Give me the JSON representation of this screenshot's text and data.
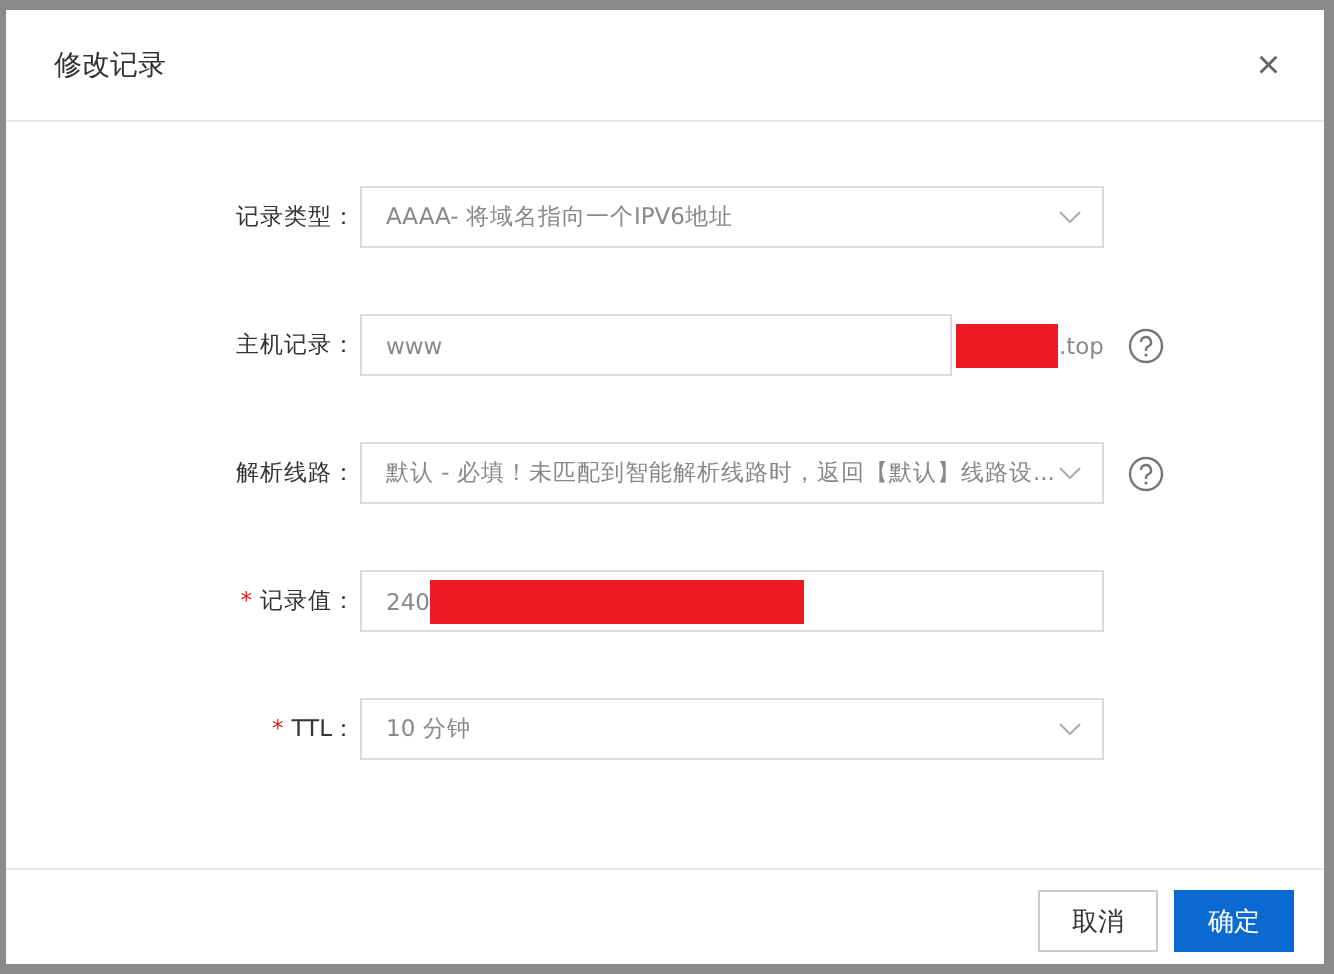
{
  "dialog": {
    "title": "修改记录",
    "close": "×"
  },
  "fields": [
    {
      "kind": "select",
      "label": "记录类型：",
      "value": "AAAA- 将域名指向一个IPV6地址",
      "help": false
    },
    {
      "kind": "input",
      "label": "主机记录：",
      "value": "www",
      "suffix_redacted": true,
      "suffix": ".top",
      "help": true
    },
    {
      "kind": "select",
      "label": "解析线路：",
      "value": "默认 - 必填！未匹配到智能解析线路时，返回【默认】线路设...",
      "help": true
    },
    {
      "kind": "input",
      "label": "记录值：",
      "mark": "*",
      "value": "240",
      "value_redacted": true,
      "help": false
    },
    {
      "kind": "select",
      "label": "TTL：",
      "mark": "*",
      "value": "10 分钟",
      "help": false
    }
  ],
  "buttons": [
    {
      "label": "取消",
      "primary": false
    },
    {
      "label": "确定",
      "primary": true
    }
  ]
}
